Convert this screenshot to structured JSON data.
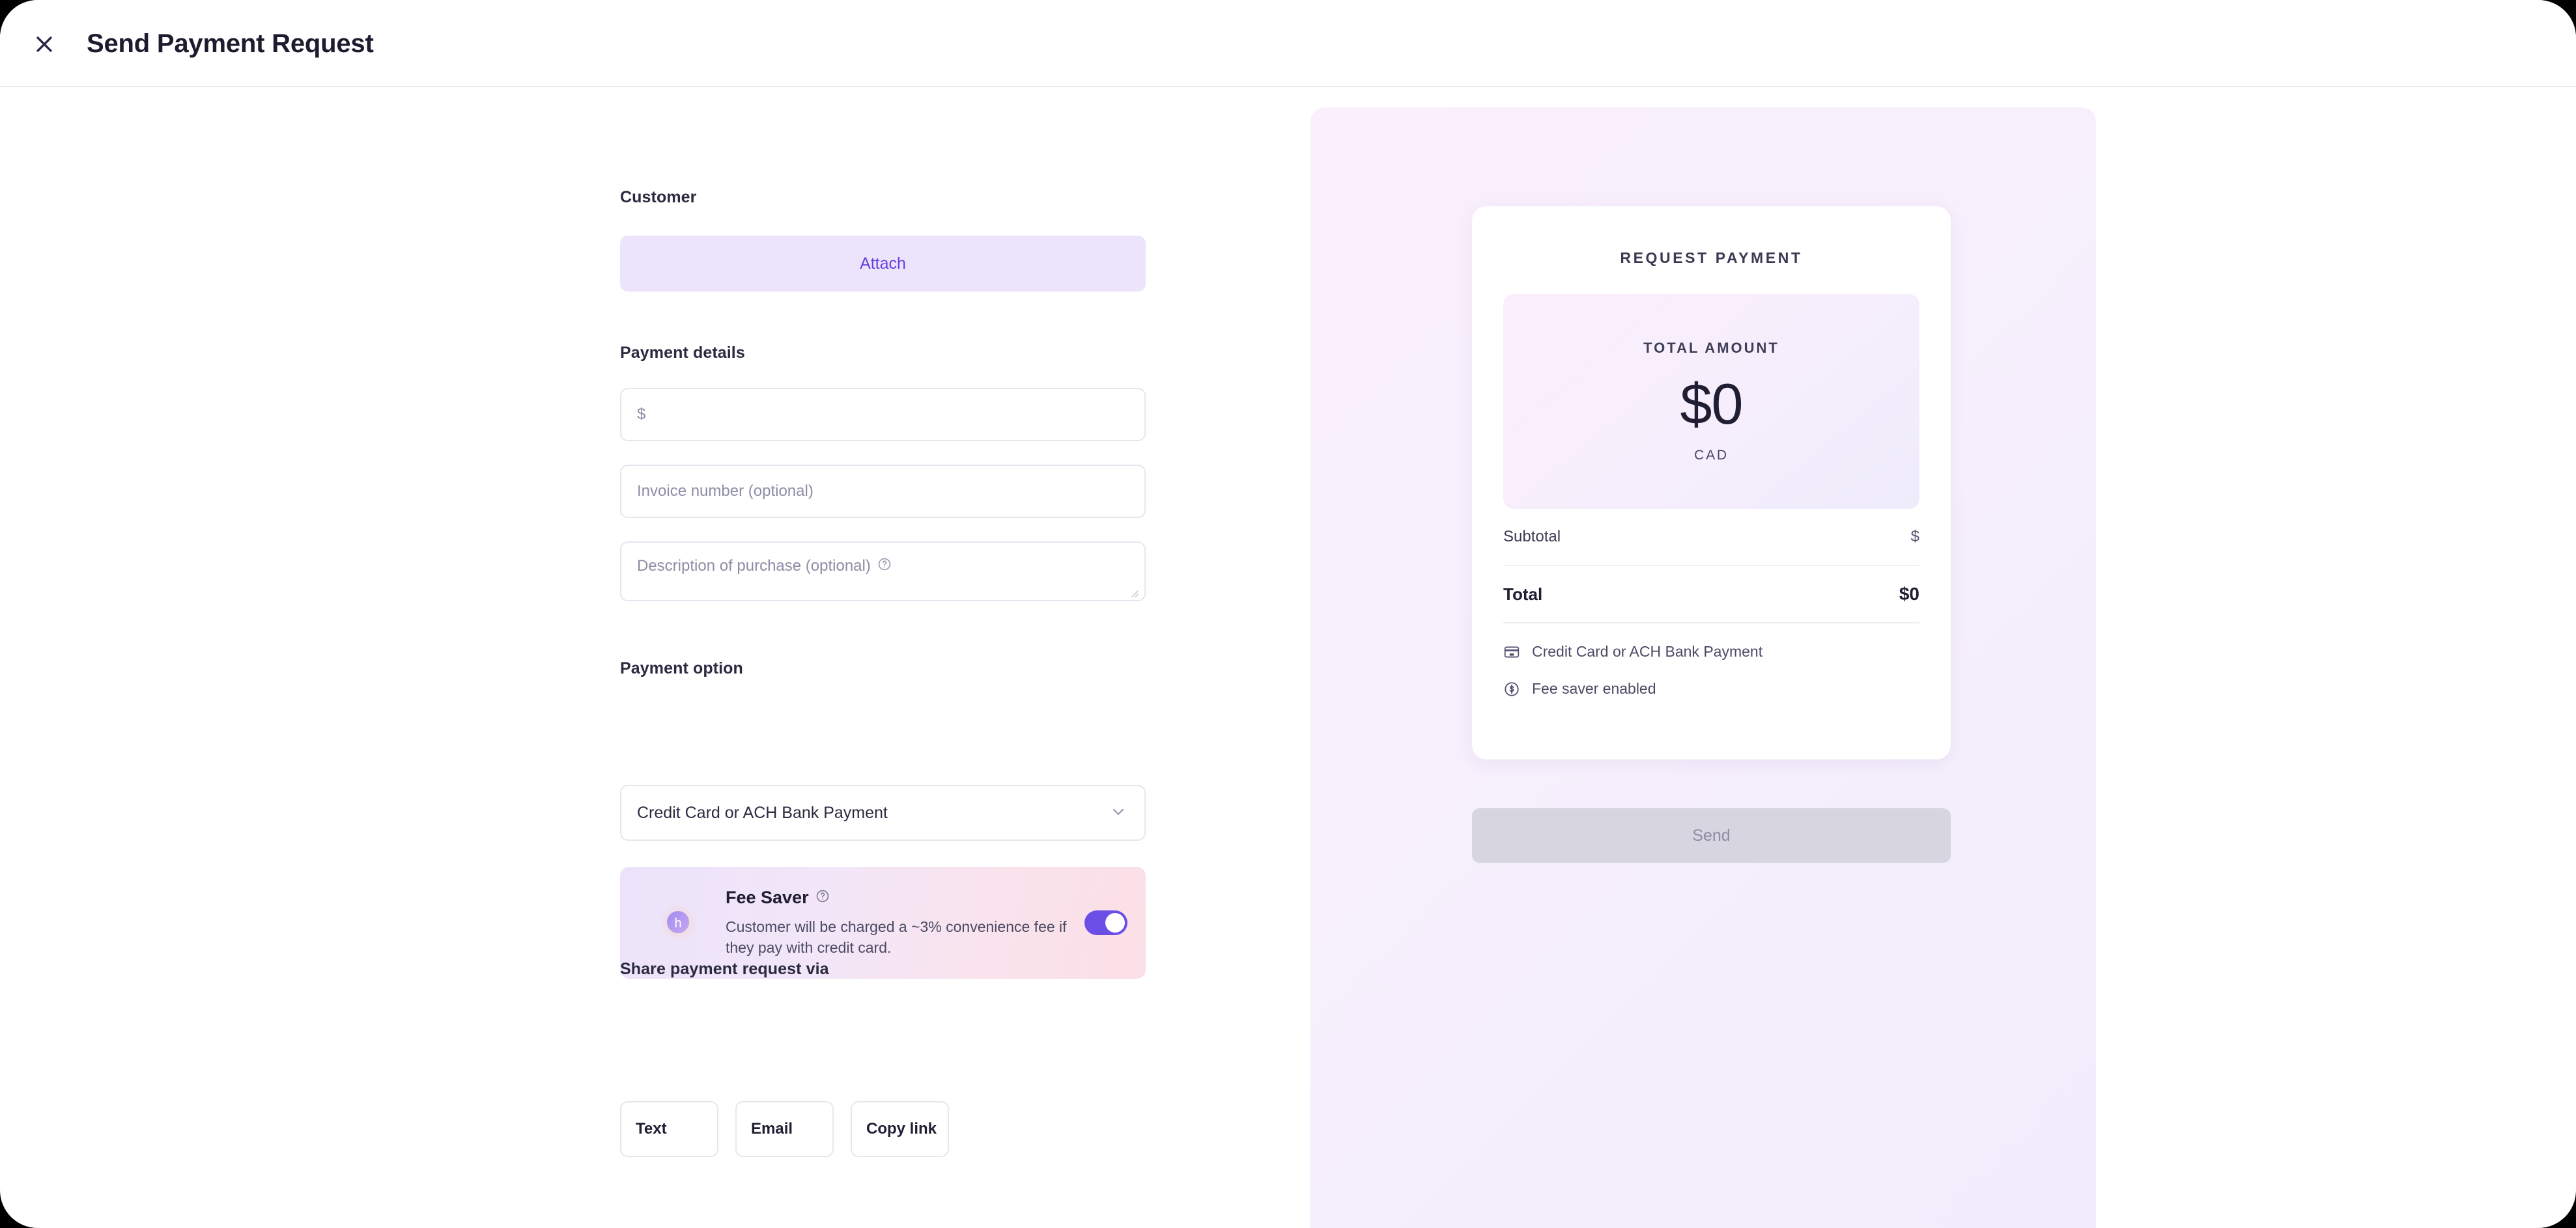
{
  "header": {
    "title": "Send Payment Request",
    "close_icon": "close-icon"
  },
  "form": {
    "customer": {
      "label": "Customer",
      "attach_label": "Attach"
    },
    "payment_details": {
      "label": "Payment details",
      "amount_placeholder": "$",
      "invoice_placeholder": "Invoice number (optional)",
      "description_placeholder": "Description of purchase (optional)",
      "description_help_icon": "help-circle-icon"
    },
    "payment_option": {
      "label": "Payment option",
      "selected": "Credit Card or ACH Bank Payment",
      "chevron_icon": "chevron-down-icon"
    },
    "fee_saver": {
      "title": "Fee Saver",
      "help_icon": "help-circle-icon",
      "description": "Customer will be charged a ~3% convenience fee if they pay with credit card.",
      "toggle_state": "on"
    },
    "share": {
      "label": "Share payment request via",
      "options": [
        {
          "label": "Text"
        },
        {
          "label": "Email"
        },
        {
          "label": "Copy link"
        }
      ]
    }
  },
  "preview": {
    "heading": "REQUEST PAYMENT",
    "amount_label": "TOTAL AMOUNT",
    "amount_value": "$0",
    "currency": "CAD",
    "summary": [
      {
        "label": "Subtotal",
        "value": "$"
      },
      {
        "label": "Total",
        "value": "$0"
      }
    ],
    "meta": [
      {
        "icon": "credit-card-icon",
        "label": "Credit Card or ACH Bank Payment"
      },
      {
        "icon": "dollar-circle-icon",
        "label": "Fee saver enabled"
      }
    ],
    "send_label": "Send"
  },
  "colors": {
    "accent_purple": "#6a3fe0",
    "toggle_on": "#6b4ee6",
    "attach_bg": "#ece4fb",
    "panel_bg": "#f5eefc",
    "disabled_btn": "#d6d5e0",
    "text_dark": "#1f1e33",
    "text_muted": "#8d8da6",
    "border": "#e6e6ef"
  }
}
